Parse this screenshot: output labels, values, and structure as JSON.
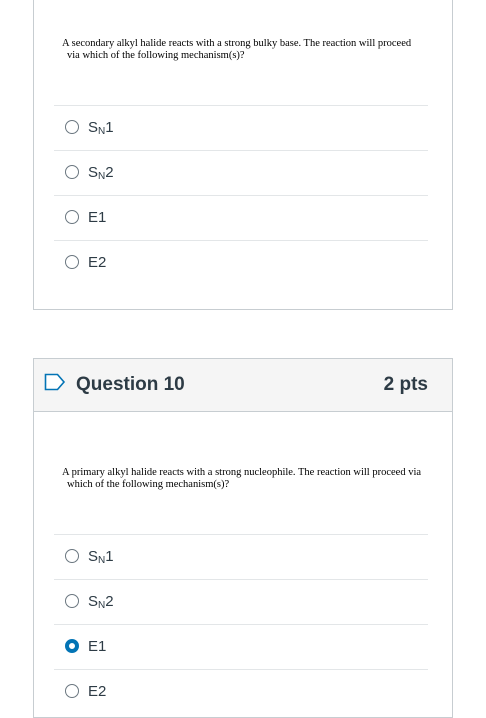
{
  "question_9": {
    "text_line1": "A secondary alkyl halide reacts with a strong bulky base. The reaction will proceed",
    "text_line2": "via which of the following mechanism(s)?",
    "answers": [
      {
        "main": "S",
        "sub": "N",
        "tail": "1",
        "selected": false
      },
      {
        "main": "S",
        "sub": "N",
        "tail": "2",
        "selected": false
      },
      {
        "main": "E1",
        "sub": "",
        "tail": "",
        "selected": false
      },
      {
        "main": "E2",
        "sub": "",
        "tail": "",
        "selected": false
      }
    ]
  },
  "question_10": {
    "title": "Question 10",
    "points": "2 pts",
    "text_line1": "A primary alkyl halide reacts with a strong nucleophile. The reaction will proceed via",
    "text_line2": "which of the following mechanism(s)?",
    "answers": [
      {
        "main": "S",
        "sub": "N",
        "tail": "1",
        "selected": false
      },
      {
        "main": "S",
        "sub": "N",
        "tail": "2",
        "selected": false
      },
      {
        "main": "E1",
        "sub": "",
        "tail": "",
        "selected": true
      },
      {
        "main": "E2",
        "sub": "",
        "tail": "",
        "selected": false
      }
    ]
  },
  "colors": {
    "accent": "#0374b5",
    "text": "#2d3b45",
    "header_bg": "#f5f5f5",
    "border": "#c7cdd1"
  },
  "icons": {
    "flag": "bookmark-flag-icon",
    "radio": "radio-button-icon"
  }
}
